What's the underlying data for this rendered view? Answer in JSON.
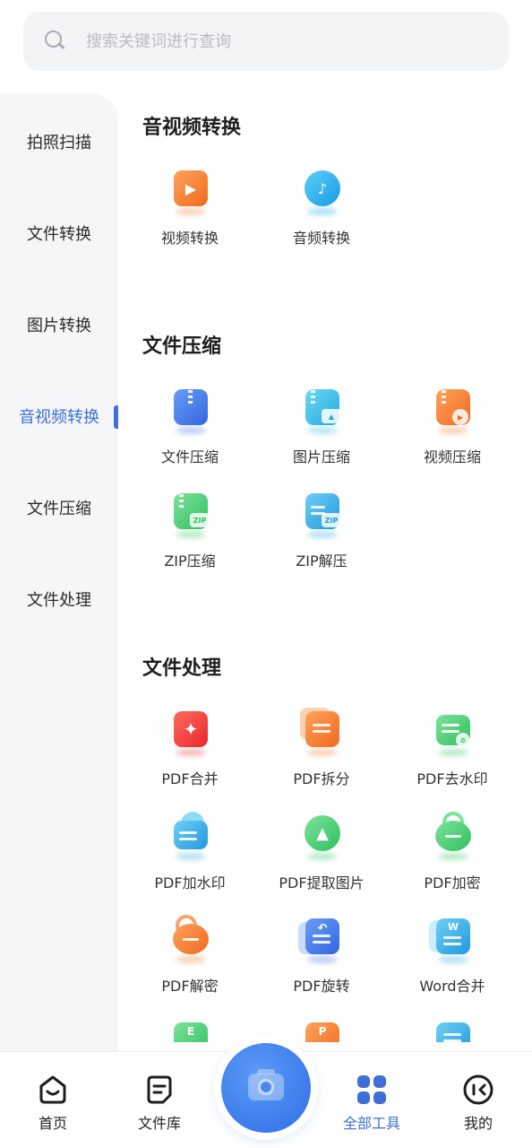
{
  "search": {
    "placeholder": "搜索关键词进行查询"
  },
  "sidebar": {
    "items": [
      {
        "label": "拍照扫描"
      },
      {
        "label": "文件转换"
      },
      {
        "label": "图片转换"
      },
      {
        "label": "音视频转换",
        "active": true
      },
      {
        "label": "文件压缩"
      },
      {
        "label": "文件处理"
      }
    ]
  },
  "sections": {
    "av": {
      "title": "音视频转换",
      "tools": [
        {
          "label": "视频转换",
          "icon": "video-convert-icon",
          "color": "#f47a2e"
        },
        {
          "label": "音频转换",
          "icon": "audio-convert-icon",
          "color": "#1aa6e8"
        }
      ]
    },
    "compress": {
      "title": "文件压缩",
      "tools": [
        {
          "label": "文件压缩",
          "icon": "file-compress-icon",
          "color": "#3f74e6"
        },
        {
          "label": "图片压缩",
          "icon": "image-compress-icon",
          "color": "#31b8e0"
        },
        {
          "label": "视频压缩",
          "icon": "video-compress-icon",
          "color": "#f2782e"
        },
        {
          "label": "ZIP压缩",
          "icon": "zip-compress-icon",
          "color": "#34c768"
        },
        {
          "label": "ZIP解压",
          "icon": "zip-extract-icon",
          "color": "#2fa8e6"
        }
      ]
    },
    "process": {
      "title": "文件处理",
      "tools": [
        {
          "label": "PDF合并",
          "icon": "pdf-merge-icon",
          "color": "#ee3b3b"
        },
        {
          "label": "PDF拆分",
          "icon": "pdf-split-icon",
          "color": "#f47a2e"
        },
        {
          "label": "PDF去水印",
          "icon": "pdf-remove-watermark-icon",
          "color": "#34c768"
        },
        {
          "label": "PDF加水印",
          "icon": "pdf-add-watermark-icon",
          "color": "#2fa8e6"
        },
        {
          "label": "PDF提取图片",
          "icon": "pdf-extract-image-icon",
          "color": "#34c768"
        },
        {
          "label": "PDF加密",
          "icon": "pdf-encrypt-icon",
          "color": "#34c768"
        },
        {
          "label": "PDF解密",
          "icon": "pdf-decrypt-icon",
          "color": "#f47a2e"
        },
        {
          "label": "PDF旋转",
          "icon": "pdf-rotate-icon",
          "color": "#3f74e6"
        },
        {
          "label": "Word合并",
          "icon": "word-merge-icon",
          "color": "#2fa8e6"
        }
      ],
      "partial_icons": [
        {
          "glyph": "E",
          "icon": "excel-icon",
          "color": "#34c768"
        },
        {
          "glyph": "P",
          "icon": "ppt-icon",
          "color": "#f47a2e"
        },
        {
          "glyph": "",
          "icon": "document-icon",
          "color": "#2fa8e6"
        }
      ]
    }
  },
  "bottom_nav": {
    "items": [
      {
        "label": "首页",
        "icon": "home-icon"
      },
      {
        "label": "文件库",
        "icon": "file-library-icon"
      },
      {
        "label": "全部工具",
        "icon": "all-tools-icon",
        "active": true
      },
      {
        "label": "我的",
        "icon": "profile-icon"
      }
    ],
    "center": {
      "icon": "camera-icon"
    }
  },
  "colors": {
    "accent": "#3e6fd6",
    "sidebar_bg": "#f5f6f8"
  }
}
